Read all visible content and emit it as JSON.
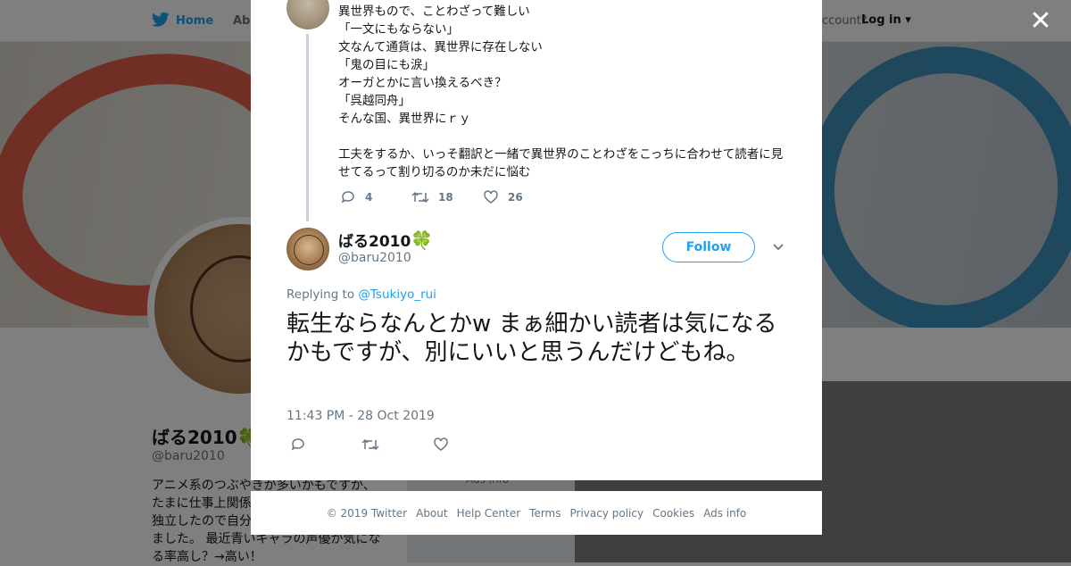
{
  "nav": {
    "home": "Home",
    "about": "Abo",
    "account": "ccount?",
    "login": "Log in"
  },
  "profile": {
    "name": "ばる2010",
    "emoji": "🍀",
    "handle": "@baru2010",
    "bio": [
      "アニメ系のつぶやきが多いかもですが、",
      "たまに仕事上関係",
      "独立したので自分",
      "ました。 最近青いキャラの声優が気にな",
      "る率高し？→高い！"
    ],
    "ghost": "Ads info"
  },
  "parent_tweet": {
    "lines": [
      "異世界もので、ことわざって難しい",
      "「一文にもならない」",
      "文なんて通貨は、異世界に存在しない",
      "「鬼の目にも涙」",
      "オーガとかに言い換えるべき？",
      "「呉越同舟」",
      "そんな国、異世界にｒｙ",
      ""
    ],
    "paragraph": "工夫をするか、いっそ翻訳と一緒で異世界のことわざをこっちに合わせて読者に見せてるって割り切るのか未だに悩む",
    "replies": "4",
    "retweets": "18",
    "likes": "26"
  },
  "tweet": {
    "name": "ばる2010",
    "emoji": "🍀",
    "handle": "@baru2010",
    "follow_label": "Follow",
    "replying_prefix": "Replying to",
    "replying_to": "@Tsukiyo_rui",
    "text": "転生ならなんとかw まぁ細かい読者は気になるかもですが、別にいいと思うんだけどもね。",
    "timestamp": "11:43 PM - 28 Oct 2019"
  },
  "footer": {
    "links": [
      "© 2019 Twitter",
      "About",
      "Help Center",
      "Terms",
      "Privacy policy",
      "Cookies",
      "Ads info"
    ]
  },
  "close_symbol": "✕",
  "colors": {
    "accent": "#1da1f2",
    "text": "#14171a",
    "muted": "#657786",
    "clover": "#3bb54a"
  }
}
